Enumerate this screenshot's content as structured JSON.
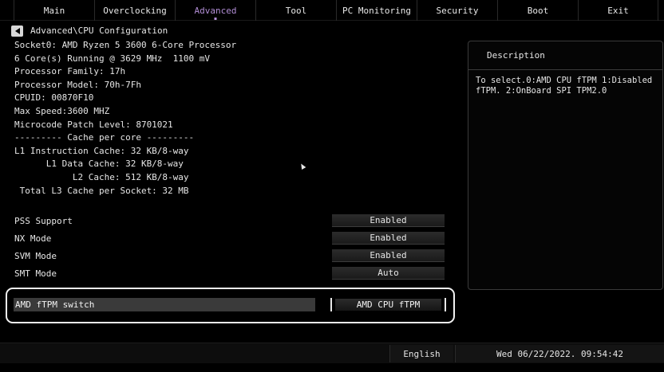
{
  "tabs": [
    {
      "label": "Main"
    },
    {
      "label": "Overclocking"
    },
    {
      "label": "Advanced"
    },
    {
      "label": "Tool"
    },
    {
      "label": "PC Monitoring"
    },
    {
      "label": "Security"
    },
    {
      "label": "Boot"
    },
    {
      "label": "Exit"
    }
  ],
  "active_tab": "Advanced",
  "breadcrumb": "Advanced\\CPU Configuration",
  "info_lines": [
    "Socket0: AMD Ryzen 5 3600 6-Core Processor",
    "6 Core(s) Running @ 3629 MHz  1100 mV",
    "Processor Family: 17h",
    "Processor Model: 70h-7Fh",
    "CPUID: 00870F10",
    "Max Speed:3600 MHZ",
    "Microcode Patch Level: 8701021",
    "--------- Cache per core ---------",
    "L1 Instruction Cache: 32 KB/8-way",
    "      L1 Data Cache: 32 KB/8-way",
    "           L2 Cache: 512 KB/8-way",
    " Total L3 Cache per Socket: 32 MB"
  ],
  "settings": [
    {
      "label": "PSS Support",
      "value": "Enabled"
    },
    {
      "label": "NX Mode",
      "value": "Enabled"
    },
    {
      "label": "SVM Mode",
      "value": "Enabled"
    },
    {
      "label": "SMT Mode",
      "value": "Auto"
    }
  ],
  "selected_setting": {
    "label": "AMD fTPM switch",
    "value": "AMD CPU fTPM"
  },
  "description": {
    "title": "Description",
    "text": "To select.0:AMD CPU fTPM 1:Disabled fTPM. 2:OnBoard SPI TPM2.0"
  },
  "footer": {
    "language": "English",
    "datetime": "Wed 06/22/2022. 09:54:42"
  },
  "colors": {
    "active_tab": "#b28ed6",
    "background": "#000000",
    "text": "#e6e6e6"
  },
  "icons": {
    "back": "back-arrow-icon",
    "pointer": "mouse-pointer-icon"
  }
}
